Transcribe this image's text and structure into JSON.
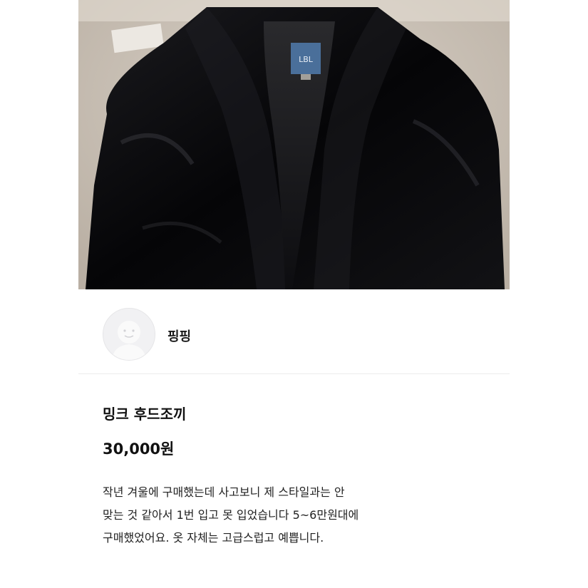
{
  "listing": {
    "image_label_text": "LBL",
    "seller_name": "핑핑",
    "title": "밍크 후드조끼",
    "price": "30,000원",
    "description_lines": [
      "작년 겨울에 구매했는데 사고보니 제 스타일과는 안",
      "맞는 것 같아서 1번 입고 못 입었습니다 5~6만원대에",
      "구매했었어요. 옷 자체는 고급스럽고 예쁩니다."
    ]
  },
  "colors": {
    "fur": "#0a0a0c",
    "background_carpet": "#cfc6bb",
    "label_blue": "#4a6f9a",
    "text": "#111111"
  }
}
